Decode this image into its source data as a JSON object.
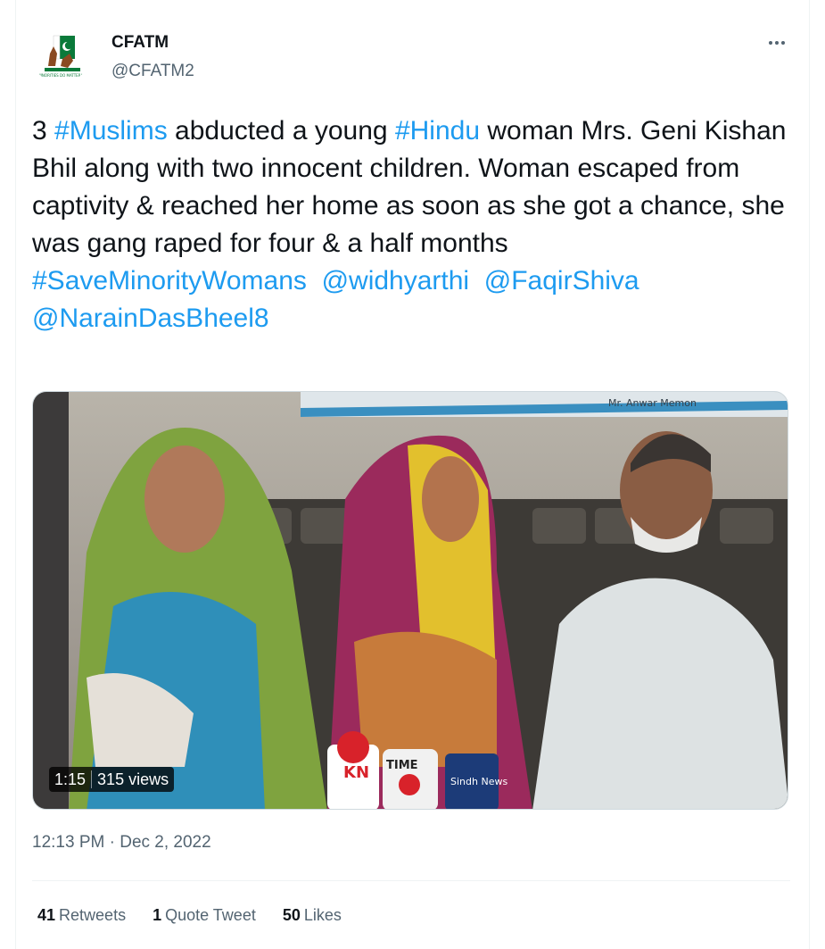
{
  "author": {
    "name": "CFATM",
    "handle": "@CFATM2",
    "avatar_caption": "MINORITIES DO MATTER!!"
  },
  "menu": {
    "icon": "more-horizontal-icon"
  },
  "tweet": {
    "segments": [
      {
        "text": "3 ",
        "link": false
      },
      {
        "text": "#Muslims",
        "link": true
      },
      {
        "text": " abducted a young ",
        "link": false
      },
      {
        "text": "#Hindu",
        "link": true
      },
      {
        "text": " woman Mrs. Geni Kishan Bhil along with two innocent children. Woman escaped from captivity & reached her home as soon as she got a chance, she was gang raped for four & a half months",
        "link": false
      }
    ],
    "hashtag_line": "#SaveMinorityWomans",
    "mentions": [
      "@widhyarthi",
      "@FaqirShiva",
      "@NarainDasBheel8"
    ]
  },
  "media": {
    "type": "video",
    "duration": "1:15",
    "views": "315 views",
    "banner_text": "Mr. Anwar Memon",
    "mic_labels": [
      "KN",
      "TIME",
      "Sindh News"
    ]
  },
  "meta": {
    "time": "12:13 PM",
    "separator": "·",
    "date": "Dec 2, 2022"
  },
  "stats": {
    "retweets": {
      "count": "41",
      "label": "Retweets"
    },
    "quotes": {
      "count": "1",
      "label": "Quote Tweet"
    },
    "likes": {
      "count": "50",
      "label": "Likes"
    }
  },
  "colors": {
    "link": "#1d9bf0",
    "text": "#0f1419",
    "secondary": "#536471",
    "border": "#eff3f4"
  }
}
